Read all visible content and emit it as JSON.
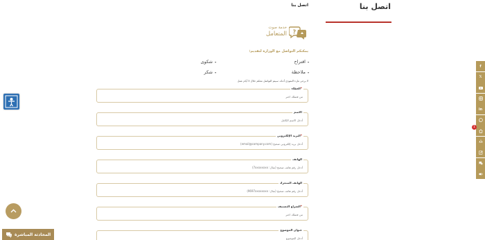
{
  "header": {
    "page_title": "اتصل بنا",
    "breadcrumb_current": "اتصل بنا"
  },
  "service": {
    "line1": "خدمة صوت",
    "line2": "المتعامل"
  },
  "form": {
    "choose_heading": "يمكنكم التواصل مع الوزارة لتقديم:",
    "types": [
      "اقتراح",
      "شكوى",
      "ملاحظة",
      "شكر"
    ],
    "note": "لا يرجى ملء النموذج أدناه. سيتم التواصل معكم خلال 3 أيام عمل",
    "fields": [
      {
        "label": "الغطاء",
        "required": true,
        "placeholder": "من فضلك اختر"
      },
      {
        "label": "الاسم",
        "required": false,
        "placeholder": "أدخل الاسم الكامل"
      },
      {
        "label": "البريد الإلكتروني",
        "required": true,
        "placeholder": "أدخل بريد إلكتروني صحيح (email@company.com)"
      },
      {
        "label": "الهاتف",
        "required": false,
        "placeholder": "أدخل رقم هاتف صحيح (مثال: 7xxxxxxxx)"
      },
      {
        "label": "الهاتف المتحرك",
        "required": false,
        "placeholder": "أدخل رقم هاتف صحيح (مثال: 9697xxxxxxxx)"
      },
      {
        "label": "الشراع التصنيف",
        "required": true,
        "placeholder": "من فضلك اختر"
      },
      {
        "label": "عنوان الموضوع",
        "required": false,
        "placeholder": "أدخل الموضوع"
      }
    ]
  },
  "chat": {
    "label": "المحادثة المباشرة"
  },
  "notifications": {
    "count": "1"
  },
  "colors": {
    "accent": "#b59a5a",
    "title_underline": "#b8322a",
    "widget_blue": "#2d6fb3",
    "badge_red": "#d32f2f"
  },
  "social": [
    "facebook-icon",
    "x-icon",
    "youtube-icon",
    "instagram-icon",
    "linkedin-icon",
    "whatsapp-icon",
    "home-icon",
    "sitemap-icon",
    "edit-icon",
    "chat-icon",
    "toggle-icon"
  ]
}
